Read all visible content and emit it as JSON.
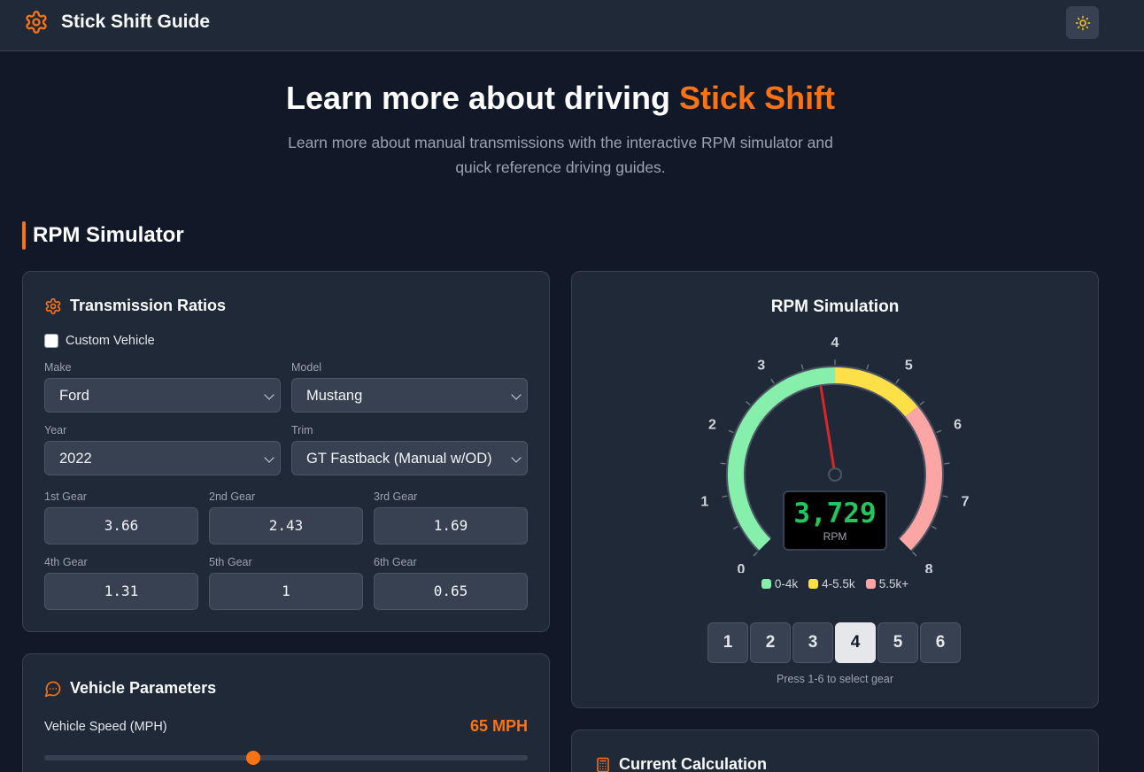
{
  "header": {
    "app_title": "Stick Shift Guide",
    "logo_icon": "gear-icon",
    "theme_icon": "sun-icon"
  },
  "hero": {
    "title_main": "Learn more about driving ",
    "title_accent": "Stick Shift",
    "subtitle": "Learn more about manual transmissions with the interactive RPM simulator and quick reference driving guides."
  },
  "section": {
    "title": "RPM Simulator"
  },
  "transmission": {
    "title": "Transmission Ratios",
    "custom_vehicle_label": "Custom Vehicle",
    "make_label": "Make",
    "make_value": "Ford",
    "model_label": "Model",
    "model_value": "Mustang",
    "year_label": "Year",
    "year_value": "2022",
    "trim_label": "Trim",
    "trim_value": "GT Fastback (Manual w/OD)",
    "gears": [
      {
        "label": "1st Gear",
        "value": "3.66"
      },
      {
        "label": "2nd Gear",
        "value": "2.43"
      },
      {
        "label": "3rd Gear",
        "value": "1.69"
      },
      {
        "label": "4th Gear",
        "value": "1.31"
      },
      {
        "label": "5th Gear",
        "value": "1"
      },
      {
        "label": "6th Gear",
        "value": "0.65"
      }
    ]
  },
  "vehicle": {
    "title": "Vehicle Parameters",
    "speed_label": "Vehicle Speed (MPH)",
    "speed_value": "65 MPH",
    "speed_fraction": 0.433
  },
  "simulation": {
    "title": "RPM Simulation",
    "rpm_value": "3,729",
    "rpm_numeric": 3729,
    "rpm_unit": "RPM",
    "ticks": [
      "0",
      "1",
      "2",
      "3",
      "4",
      "5",
      "6",
      "7",
      "8"
    ],
    "legend": [
      {
        "label": "0-4k",
        "color": "#86efac"
      },
      {
        "label": "4-5.5k",
        "color": "#fde047"
      },
      {
        "label": "5.5k+",
        "color": "#fca5a5"
      }
    ],
    "gear_buttons": [
      "1",
      "2",
      "3",
      "4",
      "5",
      "6"
    ],
    "active_gear": "4",
    "hint": "Press 1-6 to select gear"
  },
  "calculation": {
    "title": "Current Calculation"
  },
  "colors": {
    "accent": "#f97316",
    "rpm_text": "#22c55e",
    "needle": "#dc2626"
  }
}
